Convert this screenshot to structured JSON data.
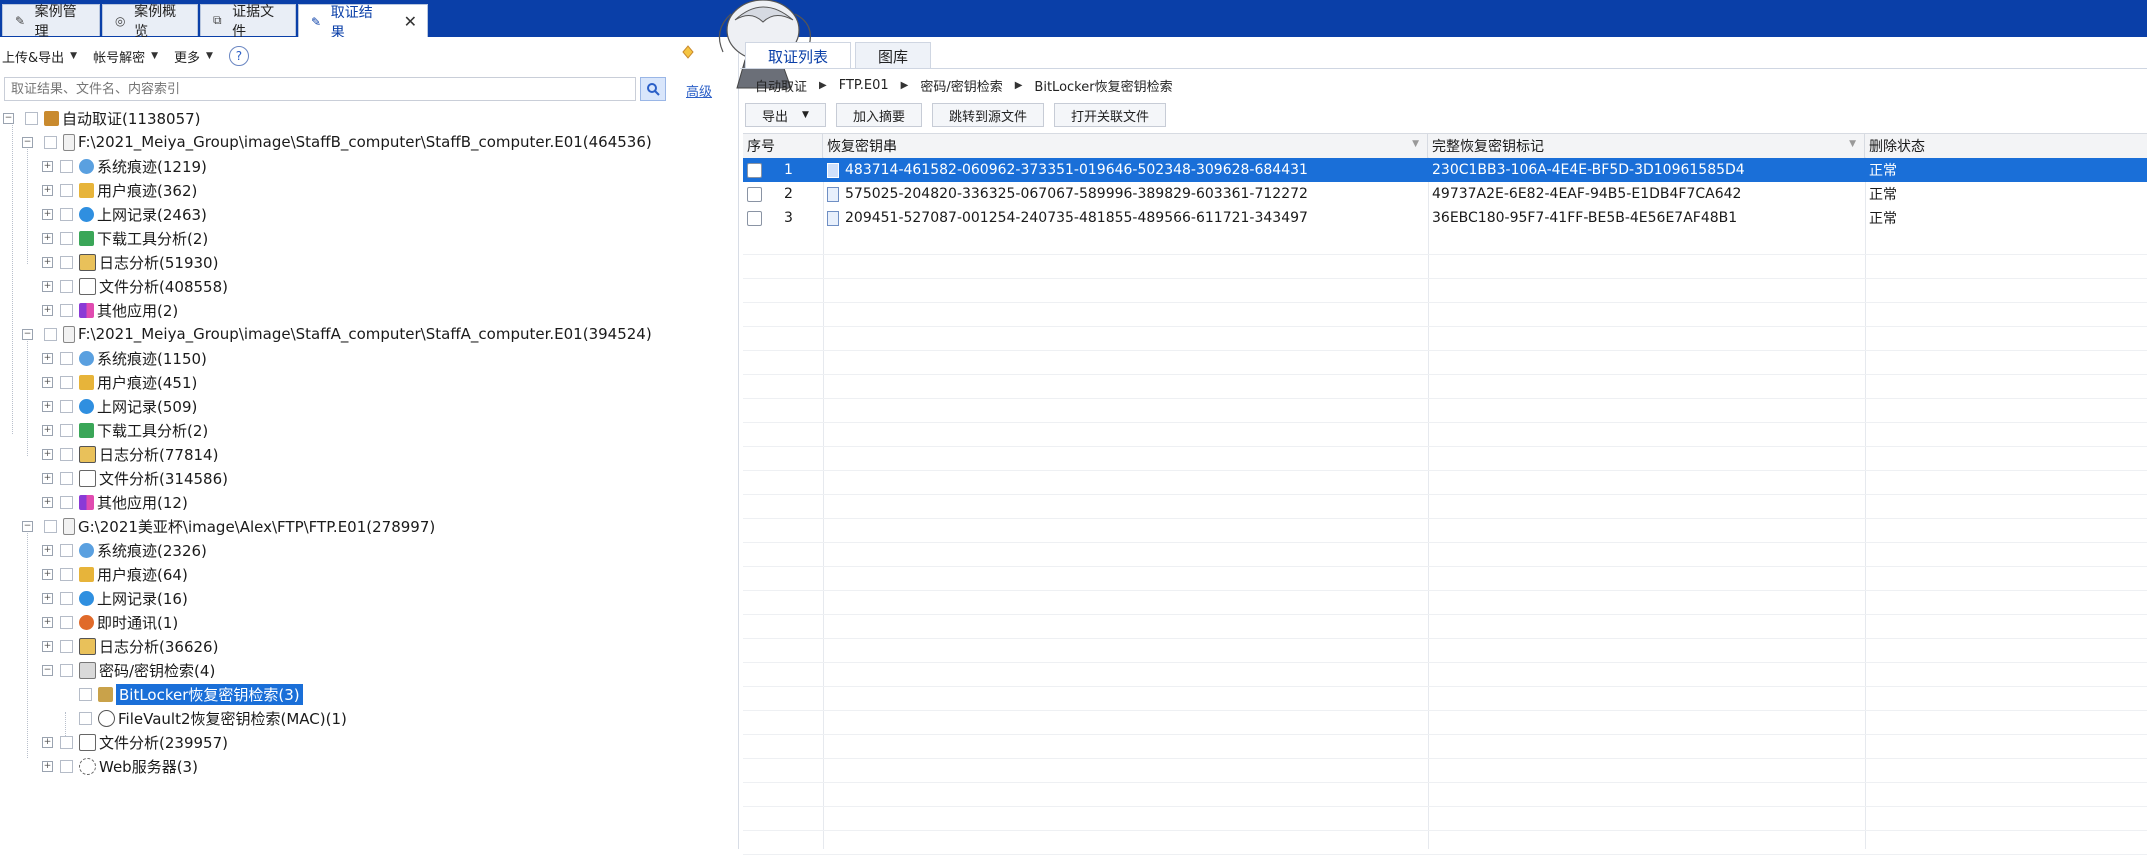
{
  "top_tabs": [
    {
      "label": "案例管理",
      "icon": "edit-icon"
    },
    {
      "label": "案例概览",
      "icon": "overview-icon"
    },
    {
      "label": "证据文件",
      "icon": "file-copy-icon"
    },
    {
      "label": "取证结果",
      "icon": "edit-icon",
      "active": true
    }
  ],
  "left_toolbar": {
    "upload_export": "上传&导出",
    "account_decrypt": "帐号解密",
    "more": "更多",
    "help": "?"
  },
  "search": {
    "placeholder": "取证结果、文件名、内容索引",
    "advanced": "高级"
  },
  "tree": {
    "root": "自动取证(1138057)",
    "e1": {
      "label": "F:\\2021_Meiya_Group\\image\\StaffB_computer\\StaffB_computer.E01(464536)",
      "children": [
        "系统痕迹(1219)",
        "用户痕迹(362)",
        "上网记录(2463)",
        "下载工具分析(2)",
        "日志分析(51930)",
        "文件分析(408558)",
        "其他应用(2)"
      ]
    },
    "e2": {
      "label": "F:\\2021_Meiya_Group\\image\\StaffA_computer\\StaffA_computer.E01(394524)",
      "children": [
        "系统痕迹(1150)",
        "用户痕迹(451)",
        "上网记录(509)",
        "下载工具分析(2)",
        "日志分析(77814)",
        "文件分析(314586)",
        "其他应用(12)"
      ]
    },
    "e3": {
      "label": "G:\\2021美亚杯\\image\\Alex\\FTP\\FTP.E01(278997)",
      "children": [
        "系统痕迹(2326)",
        "用户痕迹(64)",
        "上网记录(16)",
        "即时通讯(1)",
        "日志分析(36626)",
        "密码/密钥检索(4)"
      ],
      "pw_children": [
        "BitLocker恢复密钥检索(3)",
        "FileVault2恢复密钥检索(MAC)(1)"
      ],
      "more_children": [
        "文件分析(239957)",
        "Web服务器(3)"
      ]
    }
  },
  "right_tabs": [
    "取证列表",
    "图库"
  ],
  "breadcrumb": [
    "自动取证",
    "FTP.E01",
    "密码/密钥检索",
    "BitLocker恢复密钥检索"
  ],
  "right_buttons": {
    "export": "导出",
    "add_summary": "加入摘要",
    "jump_source": "跳转到源文件",
    "open_related": "打开关联文件"
  },
  "table": {
    "headers": [
      "序号",
      "恢复密钥串",
      "完整恢复密钥标记",
      "删除状态"
    ],
    "rows": [
      {
        "no": "1",
        "key": "483714-461582-060962-373351-019646-502348-309628-684431",
        "id": "230C1BB3-106A-4E4E-BF5D-3D10961585D4",
        "status": "正常"
      },
      {
        "no": "2",
        "key": "575025-204820-336325-067067-589996-389829-603361-712272",
        "id": "49737A2E-6E82-4EAF-94B5-E1DB4F7CA642",
        "status": "正常"
      },
      {
        "no": "3",
        "key": "209451-527087-001254-240735-481855-489566-611721-343497",
        "id": "36EBC180-95F7-41FF-BE5B-4E56E7AF48B1",
        "status": "正常"
      }
    ]
  },
  "colors": {
    "accent": "#0a3fa8",
    "selection": "#1a6fd8"
  }
}
